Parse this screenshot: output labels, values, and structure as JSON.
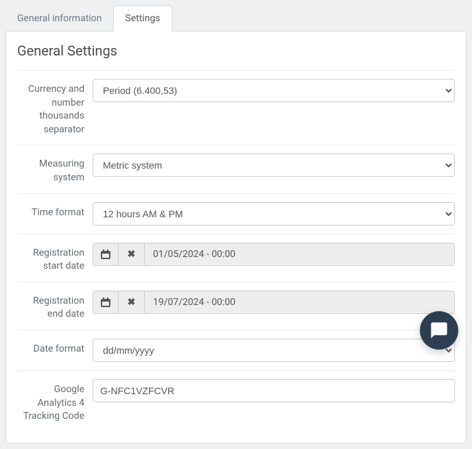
{
  "tabs": {
    "general_info": "General information",
    "settings": "Settings"
  },
  "panel": {
    "title": "General Settings"
  },
  "fields": {
    "currency_label": "Currency and number thousands separator",
    "currency_value": "Period (6.400,53)",
    "measuring_label": "Measuring system",
    "measuring_value": "Metric system",
    "timeformat_label": "Time format",
    "timeformat_value": "12 hours AM & PM",
    "reg_start_label": "Registration start date",
    "reg_start_value": "01/05/2024 - 00:00",
    "reg_end_label": "Registration end date",
    "reg_end_value": "19/07/2024 - 00:00",
    "dateformat_label": "Date format",
    "dateformat_value": "dd/mm/yyyy",
    "ga4_label": "Google Analytics 4 Tracking Code",
    "ga4_value": "G-NFC1VZFCVR"
  }
}
